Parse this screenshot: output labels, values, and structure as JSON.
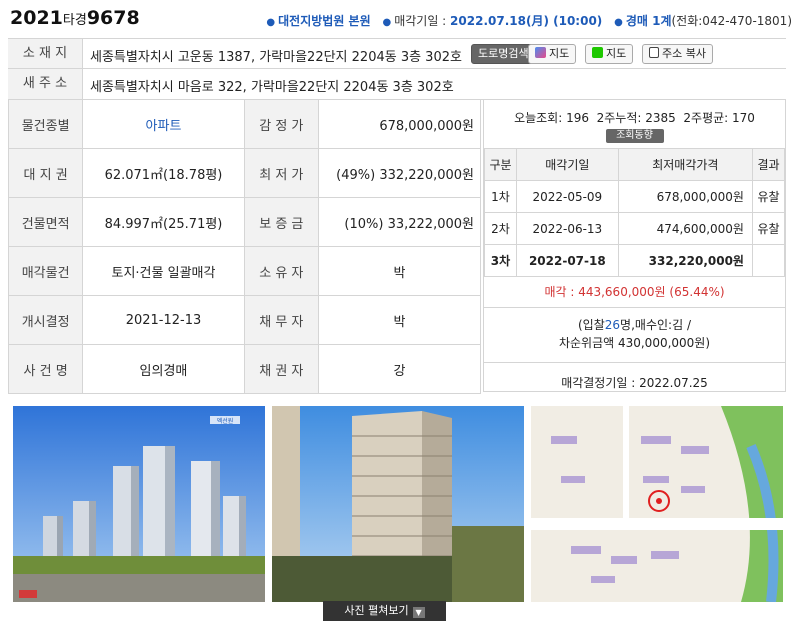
{
  "header": {
    "case_year": "2021",
    "case_type": "타경",
    "case_num": "9678",
    "court": "대전지방법원 본원",
    "date_label": "매각기일 : ",
    "date_value": "2022.07.18(月) (10:00)",
    "dept_prefix": "경매 1계",
    "dept_phone": "(전화:042-470-1801)"
  },
  "address": {
    "label": "소 재 지",
    "value": "세종특별자치시 고운동 1387, 가락마을22단지 2204동 3층 302호",
    "road_search_btn": "도로명검색",
    "map1_btn": "지도",
    "map2_btn": "지도",
    "copy_btn": "주소 복사"
  },
  "new_address": {
    "label": "새 주 소",
    "value": "세종특별자치시 마음로 322, 가락마을22단지 2204동 3층 302호"
  },
  "info": {
    "type_label": "물건종별",
    "type_value": "아파트",
    "appraise_label": "감 정 가",
    "appraise_value": "678,000,000원",
    "land_label": "대 지 권",
    "land_value": "62.071㎡(18.78평)",
    "min_label": "최 저 가",
    "min_value": "(49%) 332,220,000원",
    "bldg_label": "건물면적",
    "bldg_value": "84.997㎡(25.71평)",
    "deposit_label": "보 증 금",
    "deposit_value": "(10%) 33,222,000원",
    "sale_obj_label": "매각물건",
    "sale_obj_value": "토지·건물 일괄매각",
    "owner_label": "소 유 자",
    "owner_value": "박",
    "start_label": "개시결정",
    "start_value": "2021-12-13",
    "debtor_label": "채 무 자",
    "debtor_value": "박",
    "case_name_label": "사 건 명",
    "case_name_value": "임의경매",
    "creditor_label": "채 권 자",
    "creditor_value": "강"
  },
  "stats": {
    "text": "오늘조회: 196  2주누적: 2385  2주평균: 170",
    "trend_btn": "조회동향"
  },
  "history": {
    "headers": [
      "구분",
      "매각기일",
      "최저매각가격",
      "결과"
    ],
    "rows": [
      {
        "round": "1차",
        "date": "2022-05-09",
        "price": "678,000,000원",
        "result": "유찰"
      },
      {
        "round": "2차",
        "date": "2022-06-13",
        "price": "474,600,000원",
        "result": "유찰"
      },
      {
        "round": "3차",
        "date": "2022-07-18",
        "price": "332,220,000원",
        "result": ""
      }
    ]
  },
  "sale": {
    "label": "매각 : ",
    "amount": "443,660,000원",
    "rate": "(65.44%)"
  },
  "bid": {
    "prefix": "(입찰",
    "count": "26",
    "mid": "명,매수인:김",
    "slash": "/",
    "second": "차순위금액 430,000,000원)"
  },
  "decision": {
    "text": "매각결정기일 : 2022.07.25"
  },
  "photo_badge": "엑선원",
  "more_btn": "사진 펼쳐보기",
  "colors": {
    "accent": "#1e5bb8",
    "sale": "#d23333",
    "header_cell": "#f2f2f2",
    "border": "#d5d5d5"
  }
}
